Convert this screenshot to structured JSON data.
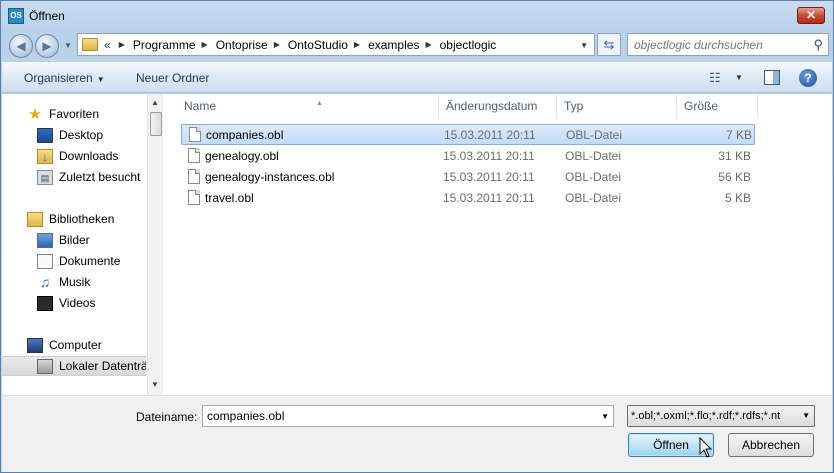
{
  "window": {
    "title": "Öffnen",
    "app_icon": "OS",
    "close_label": "✕"
  },
  "address": {
    "overflow": "«",
    "breadcrumbs": [
      "Programme",
      "Ontoprise",
      "OntoStudio",
      "examples",
      "objectlogic"
    ]
  },
  "search": {
    "placeholder": "objectlogic durchsuchen"
  },
  "toolbar": {
    "organize_label": "Organisieren",
    "new_folder_label": "Neuer Ordner"
  },
  "sidebar": {
    "items": [
      {
        "label": "Favoriten",
        "icon": "star-icon"
      },
      {
        "label": "Desktop",
        "icon": "desktop-icon"
      },
      {
        "label": "Downloads",
        "icon": "downloads-folder-icon"
      },
      {
        "label": "Zuletzt besucht",
        "icon": "recent-places-icon"
      },
      {
        "label": "Bibliotheken",
        "icon": "libraries-icon"
      },
      {
        "label": "Bilder",
        "icon": "pictures-icon"
      },
      {
        "label": "Dokumente",
        "icon": "documents-icon"
      },
      {
        "label": "Musik",
        "icon": "music-icon"
      },
      {
        "label": "Videos",
        "icon": "videos-icon"
      },
      {
        "label": "Computer",
        "icon": "computer-icon"
      },
      {
        "label": "Lokaler Datenträger",
        "icon": "drive-icon"
      }
    ]
  },
  "columns": {
    "name": "Name",
    "date": "Änderungsdatum",
    "type": "Typ",
    "size": "Größe"
  },
  "files": [
    {
      "name": "companies.obl",
      "date": "15.03.2011 20:11",
      "type": "OBL-Datei",
      "size": "7 KB"
    },
    {
      "name": "genealogy.obl",
      "date": "15.03.2011 20:11",
      "type": "OBL-Datei",
      "size": "31 KB"
    },
    {
      "name": "genealogy-instances.obl",
      "date": "15.03.2011 20:11",
      "type": "OBL-Datei",
      "size": "56 KB"
    },
    {
      "name": "travel.obl",
      "date": "15.03.2011 20:11",
      "type": "OBL-Datei",
      "size": "5 KB"
    }
  ],
  "footer": {
    "filename_label": "Dateiname:",
    "filename_value": "companies.obl",
    "filter_value": "*.obl;*.oxml;*.flo;*.rdf;*.rdfs;*.nt",
    "open_label": "Öffnen",
    "cancel_label": "Abbrechen"
  },
  "colors": {
    "selection": "#c2dcf8",
    "accent": "#3c7fb1",
    "close": "#c94a32"
  }
}
